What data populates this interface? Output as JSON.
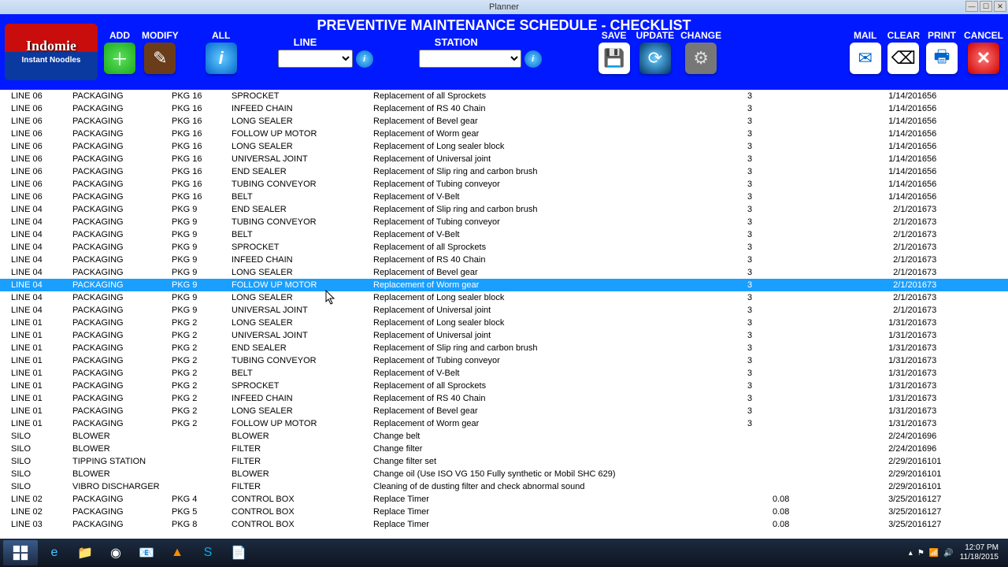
{
  "window": {
    "title": "Planner"
  },
  "logo": {
    "brand": "Indomie",
    "sub": "Instant Noodles"
  },
  "header_title": "PREVENTIVE MAINTENANCE SCHEDULE - CHECKLIST",
  "toolbar": {
    "add": "ADD",
    "modify": "MODIFY",
    "all": "ALL",
    "line": "LINE",
    "station": "STATION",
    "save": "SAVE",
    "update": "UPDATE",
    "change": "CHANGE",
    "mail": "MAIL",
    "clear": "CLEAR",
    "print": "PRINT",
    "cancel": "CANCEL"
  },
  "rows": [
    {
      "line": "LINE 06",
      "cat": "PACKAGING",
      "pkg": "PKG 16",
      "part": "SPROCKET",
      "desc": "Replacement of all Sprockets",
      "num": "3",
      "blank": "",
      "date": "1/14/2016",
      "dur": "56"
    },
    {
      "line": "LINE 06",
      "cat": "PACKAGING",
      "pkg": "PKG 16",
      "part": "INFEED CHAIN",
      "desc": "Replacement of RS 40 Chain",
      "num": "3",
      "blank": "",
      "date": "1/14/2016",
      "dur": "56"
    },
    {
      "line": "LINE 06",
      "cat": "PACKAGING",
      "pkg": "PKG 16",
      "part": "LONG SEALER",
      "desc": "Replacement of Bevel gear",
      "num": "3",
      "blank": "",
      "date": "1/14/2016",
      "dur": "56"
    },
    {
      "line": "LINE 06",
      "cat": "PACKAGING",
      "pkg": "PKG 16",
      "part": "FOLLOW UP MOTOR",
      "desc": "Replacement of Worm gear",
      "num": "3",
      "blank": "",
      "date": "1/14/2016",
      "dur": "56"
    },
    {
      "line": "LINE 06",
      "cat": "PACKAGING",
      "pkg": "PKG 16",
      "part": "LONG SEALER",
      "desc": "Replacement of Long sealer block",
      "num": "3",
      "blank": "",
      "date": "1/14/2016",
      "dur": "56"
    },
    {
      "line": "LINE 06",
      "cat": "PACKAGING",
      "pkg": "PKG 16",
      "part": "UNIVERSAL JOINT",
      "desc": "Replacement of Universal joint",
      "num": "3",
      "blank": "",
      "date": "1/14/2016",
      "dur": "56"
    },
    {
      "line": "LINE 06",
      "cat": "PACKAGING",
      "pkg": "PKG 16",
      "part": "END SEALER",
      "desc": "Replacement of Slip ring and carbon brush",
      "num": "3",
      "blank": "",
      "date": "1/14/2016",
      "dur": "56"
    },
    {
      "line": "LINE 06",
      "cat": "PACKAGING",
      "pkg": "PKG 16",
      "part": "TUBING CONVEYOR",
      "desc": "Replacement of Tubing conveyor",
      "num": "3",
      "blank": "",
      "date": "1/14/2016",
      "dur": "56"
    },
    {
      "line": "LINE 06",
      "cat": "PACKAGING",
      "pkg": "PKG 16",
      "part": "BELT",
      "desc": "Replacement of V-Belt",
      "num": "3",
      "blank": "",
      "date": "1/14/2016",
      "dur": "56"
    },
    {
      "line": "LINE 04",
      "cat": "PACKAGING",
      "pkg": "PKG 9",
      "part": "END SEALER",
      "desc": "Replacement of Slip ring and carbon brush",
      "num": "3",
      "blank": "",
      "date": "2/1/2016",
      "dur": "73"
    },
    {
      "line": "LINE 04",
      "cat": "PACKAGING",
      "pkg": "PKG 9",
      "part": "TUBING CONVEYOR",
      "desc": "Replacement of Tubing conveyor",
      "num": "3",
      "blank": "",
      "date": "2/1/2016",
      "dur": "73"
    },
    {
      "line": "LINE 04",
      "cat": "PACKAGING",
      "pkg": "PKG 9",
      "part": "BELT",
      "desc": "Replacement of V-Belt",
      "num": "3",
      "blank": "",
      "date": "2/1/2016",
      "dur": "73"
    },
    {
      "line": "LINE 04",
      "cat": "PACKAGING",
      "pkg": "PKG 9",
      "part": "SPROCKET",
      "desc": "Replacement of all Sprockets",
      "num": "3",
      "blank": "",
      "date": "2/1/2016",
      "dur": "73"
    },
    {
      "line": "LINE 04",
      "cat": "PACKAGING",
      "pkg": "PKG 9",
      "part": "INFEED CHAIN",
      "desc": "Replacement of RS 40 Chain",
      "num": "3",
      "blank": "",
      "date": "2/1/2016",
      "dur": "73"
    },
    {
      "line": "LINE 04",
      "cat": "PACKAGING",
      "pkg": "PKG 9",
      "part": "LONG SEALER",
      "desc": "Replacement of Bevel gear",
      "num": "3",
      "blank": "",
      "date": "2/1/2016",
      "dur": "73"
    },
    {
      "line": "LINE 04",
      "cat": "PACKAGING",
      "pkg": "PKG 9",
      "part": "FOLLOW UP MOTOR",
      "desc": "Replacement of Worm gear",
      "num": "3",
      "blank": "",
      "date": "2/1/2016",
      "dur": "73",
      "selected": true
    },
    {
      "line": "LINE 04",
      "cat": "PACKAGING",
      "pkg": "PKG 9",
      "part": "LONG SEALER",
      "desc": "Replacement of Long sealer block",
      "num": "3",
      "blank": "",
      "date": "2/1/2016",
      "dur": "73"
    },
    {
      "line": "LINE 04",
      "cat": "PACKAGING",
      "pkg": "PKG 9",
      "part": "UNIVERSAL JOINT",
      "desc": "Replacement of Universal joint",
      "num": "3",
      "blank": "",
      "date": "2/1/2016",
      "dur": "73"
    },
    {
      "line": "LINE 01",
      "cat": "PACKAGING",
      "pkg": "PKG 2",
      "part": "LONG SEALER",
      "desc": "Replacement of Long sealer block",
      "num": "3",
      "blank": "",
      "date": "1/31/2016",
      "dur": "73"
    },
    {
      "line": "LINE 01",
      "cat": "PACKAGING",
      "pkg": "PKG 2",
      "part": "UNIVERSAL JOINT",
      "desc": "Replacement of Universal joint",
      "num": "3",
      "blank": "",
      "date": "1/31/2016",
      "dur": "73"
    },
    {
      "line": "LINE 01",
      "cat": "PACKAGING",
      "pkg": "PKG 2",
      "part": "END SEALER",
      "desc": "Replacement of Slip ring and carbon brush",
      "num": "3",
      "blank": "",
      "date": "1/31/2016",
      "dur": "73"
    },
    {
      "line": "LINE 01",
      "cat": "PACKAGING",
      "pkg": "PKG 2",
      "part": "TUBING CONVEYOR",
      "desc": "Replacement of Tubing conveyor",
      "num": "3",
      "blank": "",
      "date": "1/31/2016",
      "dur": "73"
    },
    {
      "line": "LINE 01",
      "cat": "PACKAGING",
      "pkg": "PKG 2",
      "part": "BELT",
      "desc": "Replacement of V-Belt",
      "num": "3",
      "blank": "",
      "date": "1/31/2016",
      "dur": "73"
    },
    {
      "line": "LINE 01",
      "cat": "PACKAGING",
      "pkg": "PKG 2",
      "part": "SPROCKET",
      "desc": "Replacement of all Sprockets",
      "num": "3",
      "blank": "",
      "date": "1/31/2016",
      "dur": "73"
    },
    {
      "line": "LINE 01",
      "cat": "PACKAGING",
      "pkg": "PKG 2",
      "part": "INFEED CHAIN",
      "desc": "Replacement of RS 40 Chain",
      "num": "3",
      "blank": "",
      "date": "1/31/2016",
      "dur": "73"
    },
    {
      "line": "LINE 01",
      "cat": "PACKAGING",
      "pkg": "PKG 2",
      "part": "LONG SEALER",
      "desc": "Replacement of Bevel gear",
      "num": "3",
      "blank": "",
      "date": "1/31/2016",
      "dur": "73"
    },
    {
      "line": "LINE 01",
      "cat": "PACKAGING",
      "pkg": "PKG 2",
      "part": "FOLLOW UP MOTOR",
      "desc": "Replacement of Worm gear",
      "num": "3",
      "blank": "",
      "date": "1/31/2016",
      "dur": "73"
    },
    {
      "line": "SILO",
      "cat": "BLOWER",
      "pkg": "",
      "part": "BLOWER",
      "desc": "Change belt",
      "num": "",
      "blank": "",
      "date": "2/24/2016",
      "dur": "96"
    },
    {
      "line": "SILO",
      "cat": "BLOWER",
      "pkg": "",
      "part": "FILTER",
      "desc": "Change filter",
      "num": "",
      "blank": "",
      "date": "2/24/2016",
      "dur": "96"
    },
    {
      "line": "SILO",
      "cat": "TIPPING STATION",
      "pkg": "",
      "part": "FILTER",
      "desc": "Change filter set",
      "num": "",
      "blank": "",
      "date": "2/29/2016",
      "dur": "101"
    },
    {
      "line": "SILO",
      "cat": "BLOWER",
      "pkg": "",
      "part": "BLOWER",
      "desc": "Change oil (Use ISO VG 150 Fully synthetic or Mobil SHC 629)",
      "num": "",
      "blank": "",
      "date": "2/29/2016",
      "dur": "101"
    },
    {
      "line": "SILO",
      "cat": "VIBRO DISCHARGER",
      "pkg": "",
      "part": "FILTER",
      "desc": "Cleaning of de dusting filter and check abnormal sound",
      "num": "",
      "blank": "",
      "date": "2/29/2016",
      "dur": "101"
    },
    {
      "line": "LINE 02",
      "cat": "PACKAGING",
      "pkg": "PKG 4",
      "part": "CONTROL BOX",
      "desc": "Replace Timer",
      "num": "",
      "blank": "0.08",
      "date": "3/25/2016",
      "dur": "127"
    },
    {
      "line": "LINE 02",
      "cat": "PACKAGING",
      "pkg": "PKG 5",
      "part": "CONTROL BOX",
      "desc": "Replace Timer",
      "num": "",
      "blank": "0.08",
      "date": "3/25/2016",
      "dur": "127"
    },
    {
      "line": "LINE 03",
      "cat": "PACKAGING",
      "pkg": "PKG 8",
      "part": "CONTROL BOX",
      "desc": "Replace Timer",
      "num": "",
      "blank": "0.08",
      "date": "3/25/2016",
      "dur": "127"
    }
  ],
  "taskbar": {
    "time": "12:07 PM",
    "date": "11/18/2015"
  }
}
